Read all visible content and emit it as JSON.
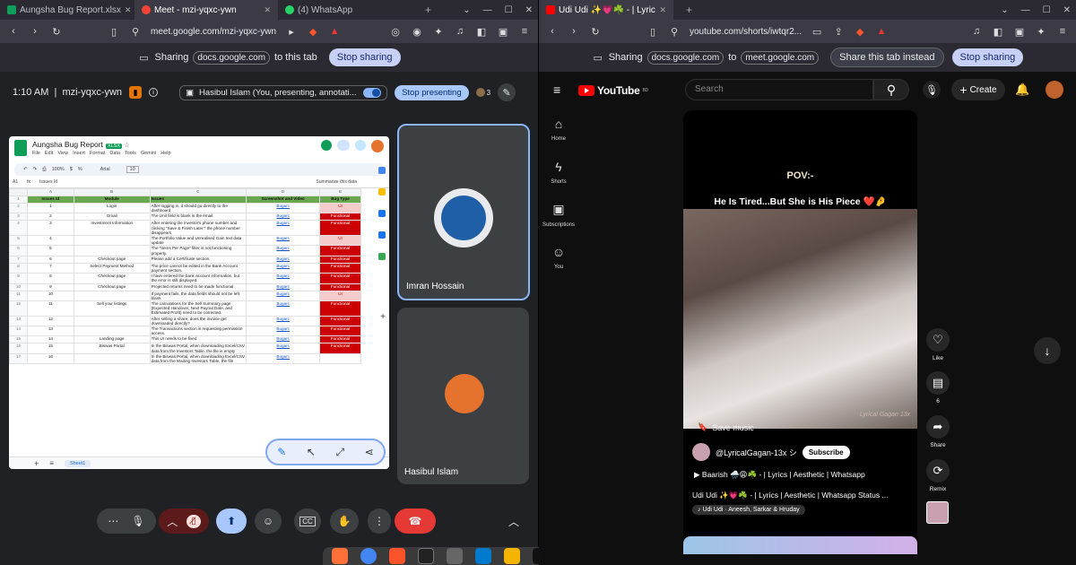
{
  "left_browser": {
    "tabs": [
      {
        "label": "Aungsha Bug Report.xlsx",
        "favicon_color": "#0f9d58"
      },
      {
        "label": "Meet - mzi-yqxc-ywn",
        "favicon_color": "#f44336"
      },
      {
        "label": "(4) WhatsApp",
        "favicon_color": "#25d366"
      }
    ],
    "url": "meet.google.com/mzi-yqxc-ywn",
    "share_bar": {
      "prefix": "Sharing",
      "source": "docs.google.com",
      "suffix": "to this tab",
      "stop_label": "Stop sharing"
    }
  },
  "right_browser": {
    "tabs": [
      {
        "label": "Udi Udi ✨💗☘️ - | Lyric",
        "favicon_color": "#ff0000"
      }
    ],
    "url": "youtube.com/shorts/iwtqr2...",
    "share_bar": {
      "prefix": "Sharing",
      "source": "docs.google.com",
      "middle": "to",
      "target": "meet.google.com",
      "share_instead_label": "Share this tab instead",
      "stop_label": "Stop sharing"
    }
  },
  "meet": {
    "time_code": "1:10 AM  |  mzi-yqxc-ywn",
    "presenting_label": "Hasibul Islam (You, presenting, annotati...",
    "stop_presenting_label": "Stop presenting",
    "participants_count": "3",
    "tiles": [
      {
        "name": "Imran Hossain",
        "avatar_color": "#1f5fa8"
      },
      {
        "name": "Hasibul Islam",
        "avatar_color": "#e5732e"
      }
    ],
    "colors": {
      "end_call": "#e53935",
      "accent": "#8ab4f8"
    }
  },
  "sheet": {
    "title": "Aungsha Bug Report",
    "badge": "XLSX",
    "menus": [
      "File",
      "Edit",
      "View",
      "Insert",
      "Format",
      "Data",
      "Tools",
      "Gemini",
      "Help"
    ],
    "toolbar": {
      "zoom": "100%",
      "font": "Arial",
      "font_size": "10"
    },
    "cell_ref": "A1",
    "formula": "Issues Id",
    "summarize": "Summarize this data",
    "col_letters": [
      "A",
      "B",
      "C",
      "D",
      "E"
    ],
    "headers": [
      "Issues Id",
      "Module",
      "Issues",
      "Screenshot and Video",
      "Bug Type"
    ],
    "rows": [
      {
        "rn": "2",
        "id": "1",
        "module": "Login",
        "issue": "After logging in, it should go directly to the dashboard.",
        "link": "Bugarc",
        "type": "UI"
      },
      {
        "rn": "3",
        "id": "2",
        "module": "Gmail",
        "issue": "The Unit field is blank in the email.",
        "link": "Bugarc",
        "type": "Functional"
      },
      {
        "rn": "4",
        "id": "3",
        "module": "Investment Information",
        "issue": "After entering the investor's phone number and clicking \"Save & Finish Later,\" the phone number disappears.",
        "link": "Bugarc",
        "type": "Functional"
      },
      {
        "rn": "5",
        "id": "4",
        "module": "",
        "issue": "The Portfolio Value and Unrealised Gain text data update",
        "link": "Bugarc",
        "type": "UI"
      },
      {
        "rn": "6",
        "id": "5",
        "module": "",
        "issue": "The \"Items Per Page\" filter is not functioning properly.",
        "link": "Bugarc",
        "type": "Functional"
      },
      {
        "rn": "7",
        "id": "6",
        "module": "Checkout page",
        "issue": "Please add a Certificate section.",
        "link": "Bugarc",
        "type": "Functional"
      },
      {
        "rn": "8",
        "id": "7",
        "module": "Select Payment Method",
        "issue": "The price cannot be edited in the Bank Account payment section.",
        "link": "Bugarc",
        "type": "Functional"
      },
      {
        "rn": "9",
        "id": "8",
        "module": "Checkout page",
        "issue": "I have entered the bank account information, but the error is still displayed.",
        "link": "Bugarc",
        "type": "Functional"
      },
      {
        "rn": "10",
        "id": "9",
        "module": "Checkout page",
        "issue": "Projected returns need to be made functional",
        "link": "Bugarc",
        "type": "Functional"
      },
      {
        "rn": "11",
        "id": "10",
        "module": "",
        "issue": "If payment fails, the data fields should not be left blank",
        "link": "Bugarc",
        "type": "UI"
      },
      {
        "rn": "12",
        "id": "11",
        "module": "Sell your listings",
        "issue": "The calculations for the Sell Summary page (Expected Handover, Next Payout Date, and Estimated Profit) need to be corrected.",
        "link": "Bugarc",
        "type": "Functional"
      },
      {
        "rn": "13",
        "id": "12",
        "module": "",
        "issue": "After selling a share, does the invoice get downloaded directly?",
        "link": "Bugarc",
        "type": "Functional"
      },
      {
        "rn": "14",
        "id": "13",
        "module": "",
        "issue": "The Transactions section is requesting permission access.",
        "link": "Bugarc",
        "type": "Functional"
      },
      {
        "rn": "15",
        "id": "14",
        "module": "Landing page",
        "issue": "This UI needs to be fixed",
        "link": "Bugarc",
        "type": "Functional"
      },
      {
        "rn": "16",
        "id": "15",
        "module": "Biswas Portal",
        "issue": "In the Biswas Portal, when downloading Excel/CSV data from the Investors Table, the file is empty",
        "link": "Bugarc",
        "type": "Functional"
      },
      {
        "rn": "17",
        "id": "16",
        "module": "",
        "issue": "In the Biswas Portal, when downloading Excel/CSV data from the Waiting Investors Table, the file",
        "link": "Bugarc",
        "type": ""
      }
    ],
    "sheet_tab": "Sheet1"
  },
  "youtube": {
    "logo": "YouTube",
    "region": "BD",
    "search_placeholder": "Search",
    "create_label": "Create",
    "nav": [
      {
        "label": "Home",
        "icon": "home-icon"
      },
      {
        "label": "Shorts",
        "icon": "shorts-icon"
      },
      {
        "label": "Subscriptions",
        "icon": "subscriptions-icon"
      },
      {
        "label": "You",
        "icon": "you-icon"
      }
    ],
    "short": {
      "overlay_line1": "POV:-",
      "overlay_line2": "He Is Tired...But She is His Piece ❤️🤌",
      "watermark": "Lyrical Gagan 13x",
      "save_music": "Save music",
      "channel": "@LyricalGagan-13x シ",
      "subscribe": "Subscribe",
      "song_line": "▶ Baarish 🌧️😩☘️ - | Lyrics | Aesthetic | Whatsapp",
      "title": "Udi Udi ✨💗☘️ - | Lyrics | Aesthetic | Whatsapp Status ...",
      "music": "♪ Udi Udi · Aneesh, Sarkar & Hruday"
    },
    "actions": [
      {
        "label": "Like",
        "icon": "heart-icon"
      },
      {
        "label": "6",
        "icon": "comment-icon"
      },
      {
        "label": "Share",
        "icon": "share-icon"
      },
      {
        "label": "Remix",
        "icon": "remix-icon"
      }
    ]
  }
}
